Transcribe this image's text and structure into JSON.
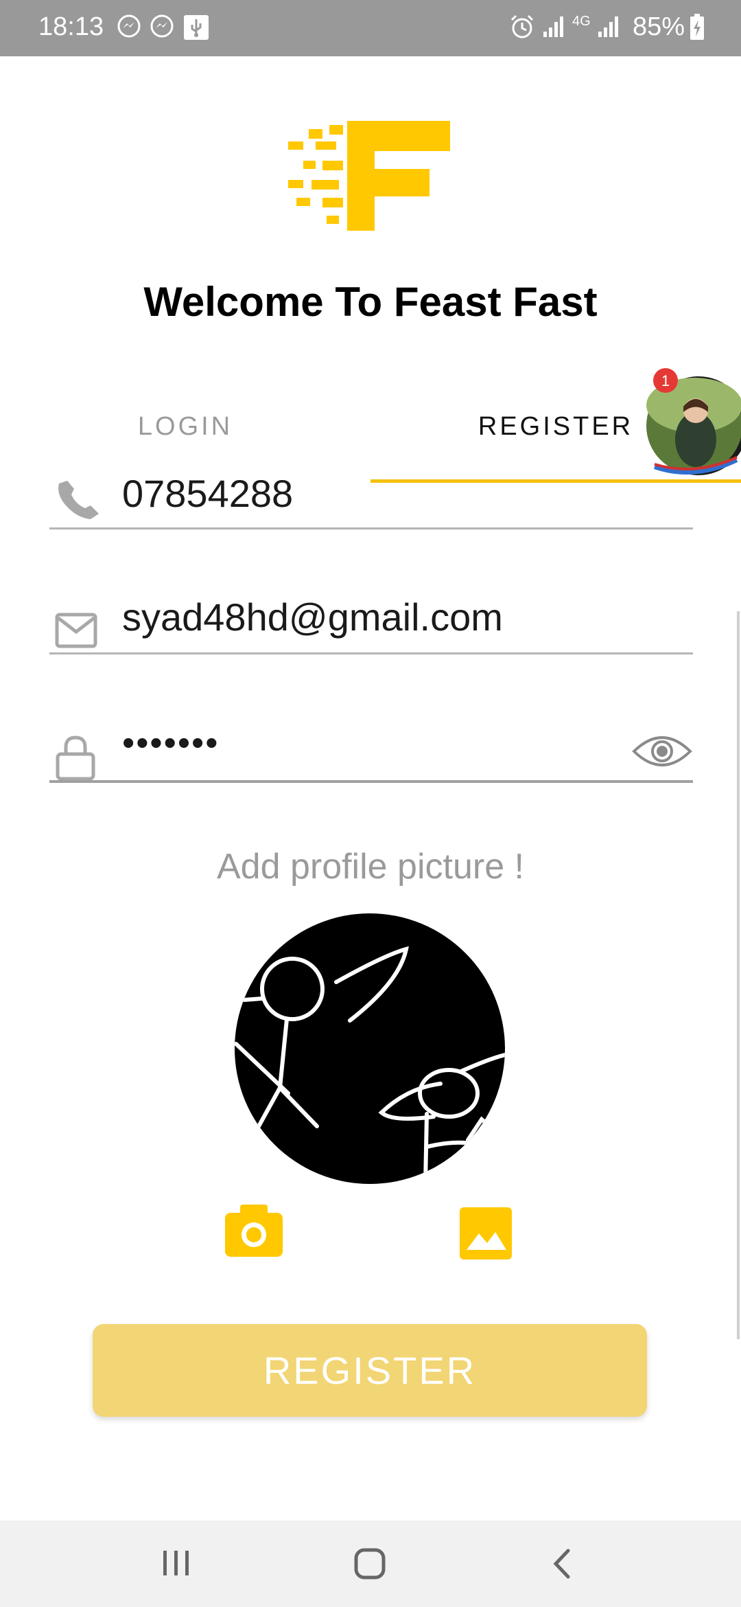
{
  "status_bar": {
    "time": "18:13",
    "battery": "85%",
    "icons": [
      "messenger-icon",
      "messenger-icon",
      "usb-icon",
      "alarm-icon",
      "signal-icon",
      "4g-icon",
      "signal-icon",
      "battery-charging-icon"
    ],
    "network_label": "4G"
  },
  "header": {
    "logo_icon": "feast-fast-logo",
    "brand_color": "#FFC800",
    "title": "Welcome To Feast Fast"
  },
  "tabs": [
    {
      "label": "LOGIN",
      "active": false
    },
    {
      "label": "REGISTER",
      "active": true
    }
  ],
  "chat_head": {
    "badge": "1",
    "icon": "chat-head-avatar"
  },
  "form": {
    "phone": {
      "icon": "phone-icon",
      "value": "07854288"
    },
    "email": {
      "icon": "mail-icon",
      "value": "syad48hd@gmail.com"
    },
    "password": {
      "icon": "lock-icon",
      "value": "•••••••",
      "toggle_icon": "eye-icon"
    }
  },
  "profile": {
    "prompt": "Add profile picture !",
    "image": "profile-drawing",
    "camera_icon": "camera-icon",
    "gallery_icon": "gallery-icon"
  },
  "register_button": {
    "label": "REGISTER"
  },
  "nav_bar": {
    "icons": [
      "recent-apps-icon",
      "home-icon",
      "back-icon"
    ]
  }
}
